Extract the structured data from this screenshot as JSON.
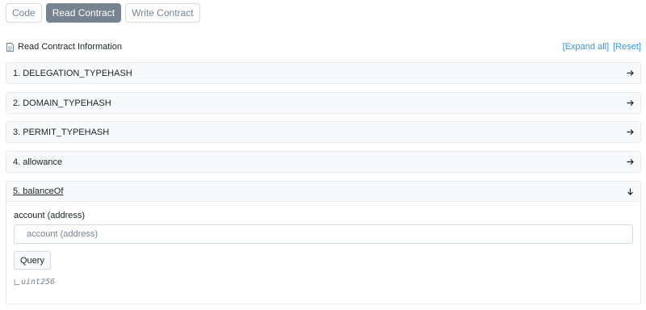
{
  "tabs": [
    {
      "label": "Code",
      "active": false
    },
    {
      "label": "Read Contract",
      "active": true
    },
    {
      "label": "Write Contract",
      "active": false
    }
  ],
  "info": {
    "title": "Read Contract Information",
    "expand_all": "[Expand all]",
    "reset": "[Reset]"
  },
  "functions": [
    {
      "label": "1. DELEGATION_TYPEHASH",
      "expanded": false
    },
    {
      "label": "2. DOMAIN_TYPEHASH",
      "expanded": false
    },
    {
      "label": "3. PERMIT_TYPEHASH",
      "expanded": false
    },
    {
      "label": "4. allowance",
      "expanded": false
    },
    {
      "label": "5. balanceOf",
      "expanded": true,
      "input_label": "account (address)",
      "input_placeholder": "account (address)",
      "input_value": "",
      "query_label": "Query",
      "output_type": "uint256"
    }
  ],
  "colors": {
    "accent": "#3498db",
    "tab_active_bg": "#77838f",
    "panel_header_bg": "#f8f9fa",
    "border": "#e7eaf3"
  },
  "icons": {
    "doc": "file-document-icon",
    "collapsed": "arrow-right-icon",
    "expanded": "arrow-down-icon",
    "output": "branch-corner-icon"
  }
}
